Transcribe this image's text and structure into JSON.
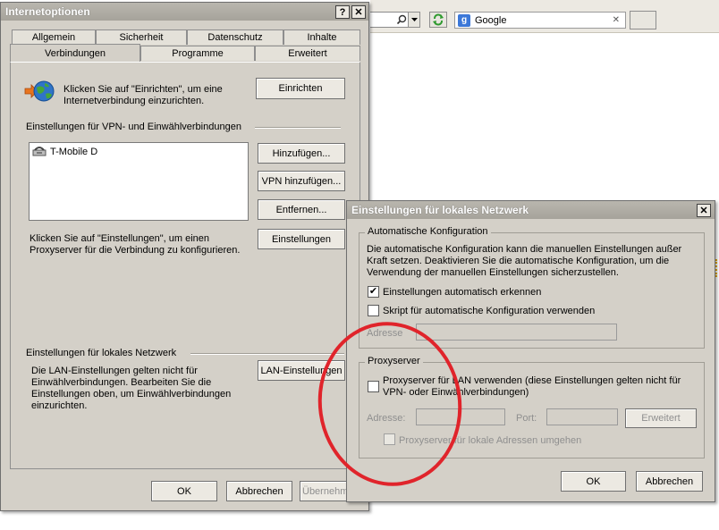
{
  "browser": {
    "search_provider": "Google",
    "close_glyph": "✕"
  },
  "internet_options": {
    "title": "Internetoptionen",
    "help_glyph": "?",
    "close_glyph": "✕",
    "tabs_row1": [
      "Allgemein",
      "Sicherheit",
      "Datenschutz",
      "Inhalte"
    ],
    "tabs_row2": [
      "Verbindungen",
      "Programme",
      "Erweitert"
    ],
    "active_tab": "Verbindungen",
    "setup_text": "Klicken Sie auf \"Einrichten\", um eine Internetverbindung einzurichten.",
    "setup_button": "Einrichten",
    "vpn_section_label": "Einstellungen für VPN- und Einwählverbindungen",
    "connections": [
      "T-Mobile D"
    ],
    "add_button": "Hinzufügen...",
    "add_vpn_button": "VPN hinzufügen...",
    "remove_button": "Entfernen...",
    "settings_button": "Einstellungen",
    "proxy_text": "Klicken Sie auf \"Einstellungen\", um einen Proxyserver für die Verbindung zu konfigurieren.",
    "lan_section_label": "Einstellungen für lokales Netzwerk",
    "lan_text": "Die LAN-Einstellungen gelten nicht für Einwählverbindungen. Bearbeiten Sie die Einstellungen oben, um Einwählverbindungen einzurichten.",
    "lan_button": "LAN-Einstellungen",
    "ok_button": "OK",
    "cancel_button": "Abbrechen",
    "apply_button": "Übernehmen"
  },
  "lan_dialog": {
    "title": "Einstellungen für lokales Netzwerk",
    "close_glyph": "✕",
    "auto_group_title": "Automatische Konfiguration",
    "auto_text": "Die automatische Konfiguration kann die manuellen Einstellungen außer Kraft setzen. Deaktivieren Sie die automatische Konfiguration, um die Verwendung der manuellen Einstellungen sicherzustellen.",
    "auto_detect_label": "Einstellungen automatisch erkennen",
    "auto_detect_checked": true,
    "script_label": "Skript für automatische Konfiguration verwenden",
    "script_checked": false,
    "script_address_label": "Adresse",
    "proxy_group_title": "Proxyserver",
    "use_proxy_label": "Proxyserver für LAN verwenden (diese Einstellungen gelten nicht für VPN- oder Einwählverbindungen)",
    "use_proxy_checked": false,
    "address_label": "Adresse:",
    "port_label": "Port:",
    "advanced_button": "Erweitert",
    "bypass_label": "Proxyserver für lokale Adressen umgehen",
    "bypass_checked": false,
    "ok_button": "OK",
    "cancel_button": "Abbrechen"
  },
  "colors": {
    "annotation_circle": "#e0242b",
    "window_face": "#d4d0c8"
  },
  "icons": {
    "connection_wizard": "globe-arrow-icon",
    "dialup": "modem-phone-icon"
  }
}
